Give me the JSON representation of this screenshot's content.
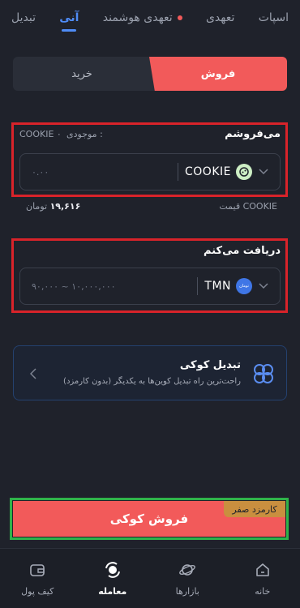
{
  "tabs": [
    {
      "label": "اسپات"
    },
    {
      "label": "تعهدی"
    },
    {
      "label": "تعهدی هوشمند"
    },
    {
      "label": "آنی"
    },
    {
      "label": "تبدیل"
    }
  ],
  "toggle": {
    "sell": "فروش",
    "buy": "خرید"
  },
  "sell_section": {
    "title": "می‌فروشم",
    "balance_label": "موجودی :",
    "balance_value": "COOKIE ۰",
    "asset": "COOKIE",
    "amount_placeholder": "۰.۰۰"
  },
  "price": {
    "label": "قیمت COOKIE",
    "value": "۱۹,۶۱۶",
    "unit": "تومان"
  },
  "receive_section": {
    "title": "دریافت می‌کنم",
    "asset": "TMN",
    "asset_badge": "تومان",
    "range_placeholder": "۹۰,۰۰۰ ~ ۱۰,۰۰۰,۰۰۰"
  },
  "convert_card": {
    "title": "تبدیل کوکی",
    "subtitle": "راحت‌ترین راه تبدیل کوین‌ها به یکدیگر (بدون کارمزد)"
  },
  "action": {
    "fee_badge": "کارمزد صفر",
    "sell_button": "فروش کوکی"
  },
  "bottom_nav": [
    {
      "label": "خانه",
      "icon": "home-icon"
    },
    {
      "label": "بازارها",
      "icon": "planet-icon"
    },
    {
      "label": "معامله",
      "icon": "trade-icon"
    },
    {
      "label": "کیف پول",
      "icon": "wallet-icon"
    }
  ],
  "colors": {
    "accent": "#f25a5a",
    "active_tab": "#4f8cf7",
    "fee_badge": "#c98f3f",
    "background": "#1f222b"
  }
}
